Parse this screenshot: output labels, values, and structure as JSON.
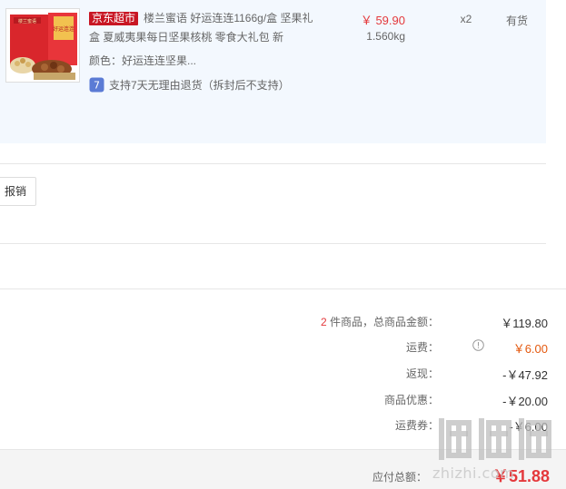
{
  "order_item": {
    "badge": "京东超市",
    "title": "楼兰蜜语 好运连连1166g/盒 坚果礼盒 夏威夷果每日坚果核桃 零食大礼包 新",
    "price": "￥ 59.90",
    "weight": "1.560kg",
    "quantity": "x2",
    "stock": "有货",
    "color": "颜色：好运连连坚果...",
    "service": "支持7天无理由退货（拆封后不支持）",
    "thumbnail_brand": "楼兰蜜语",
    "thumbnail_box_text": "好运连连"
  },
  "invoice": {
    "button_label": "报销"
  },
  "summary": {
    "items_count": "2",
    "items_label": "件商品，总商品金额：",
    "items_total": "￥119.80",
    "shipping_label": "运费：",
    "shipping_value": "￥6.00",
    "cashback_label": "返现：",
    "cashback_value": "-￥47.92",
    "discount_label": "商品优惠：",
    "discount_value": "-￥20.00",
    "shipping_coupon_label": "运费券：",
    "shipping_coupon_value": "-￥6.00"
  },
  "payment": {
    "label": "应付总额：",
    "value": "￥51.88"
  },
  "watermark": {
    "text": "zhizhi.com"
  },
  "colors": {
    "accent_red": "#e4393c",
    "badge_red": "#c81623",
    "panel_bg": "#f3f8fe",
    "bar_bg": "#f4f4f4"
  },
  "icons": {
    "service": "return-policy-icon",
    "shipping_info": "info-circle-icon"
  }
}
